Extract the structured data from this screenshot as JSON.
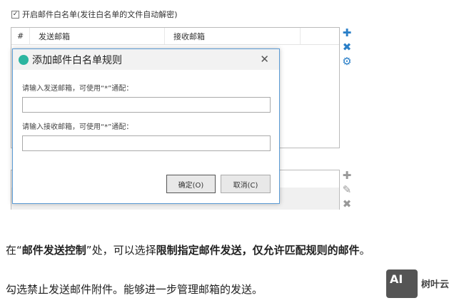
{
  "whitelist_checkbox": {
    "checked": true,
    "label": "开启邮件白名单(发往白名单的文件自动解密)"
  },
  "table": {
    "columns": [
      "#",
      "发送邮箱",
      "接收邮箱"
    ]
  },
  "side_icons_top": [
    "plus-icon",
    "close-icon",
    "gear-icon"
  ],
  "side_icons_bottom": [
    "plus-icon",
    "pencil-icon",
    "close-icon"
  ],
  "dialog": {
    "title": "添加邮件白名单规则",
    "sender_label": "请输入发送邮箱，可使用“*”通配：",
    "sender_value": "",
    "receiver_label": "请输入接收邮箱，可使用“*”通配：",
    "receiver_value": "",
    "ok": "确定(O)",
    "cancel": "取消(C)"
  },
  "article": {
    "p1": [
      {
        "t": "在“",
        "b": false
      },
      {
        "t": "邮件发送控制",
        "b": true
      },
      {
        "t": "”处，可以选择",
        "b": false
      },
      {
        "t": "限制指定邮件发送，仅允许匹配规则的邮件",
        "b": true
      },
      {
        "t": "。",
        "b": false
      }
    ],
    "p2": "勾选禁止发送邮件附件。能够进一步管理邮箱的发送。"
  },
  "watermark": {
    "logo": "AI",
    "text": "树叶云"
  }
}
